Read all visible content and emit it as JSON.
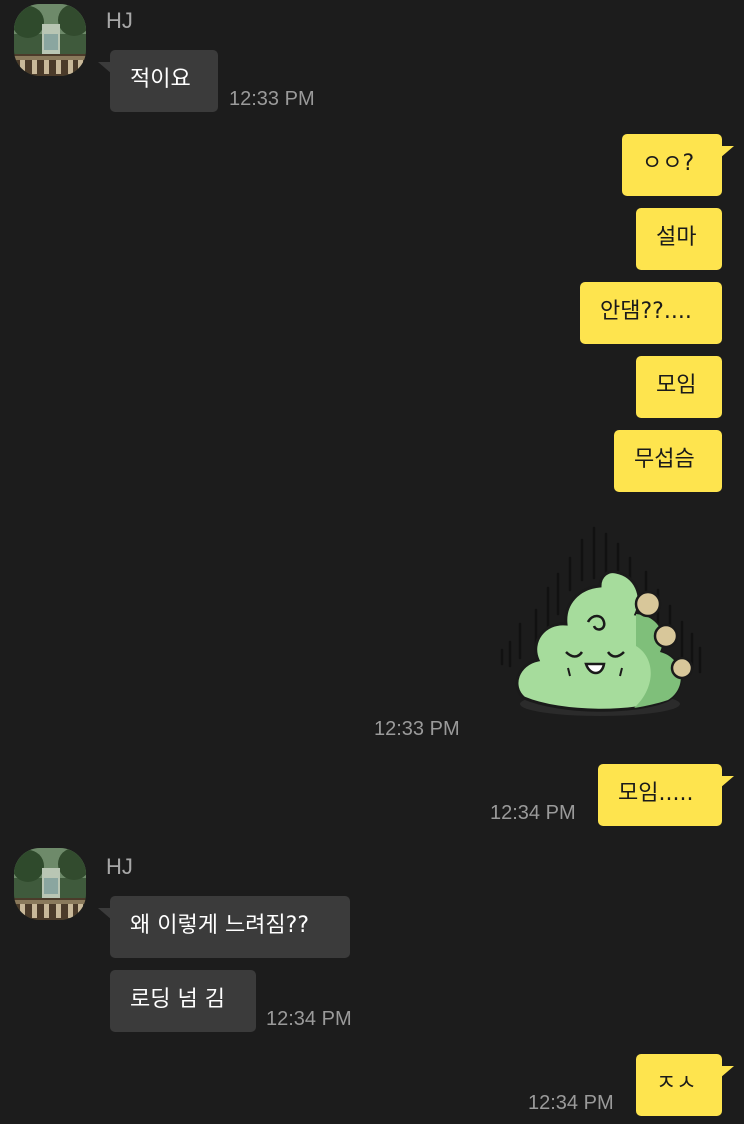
{
  "messages": {
    "m1": {
      "sender": "HJ",
      "text": "적이요",
      "time": "12:33 PM"
    },
    "m2": {
      "text": "ㅇㅇ?"
    },
    "m3": {
      "text": "설마"
    },
    "m4": {
      "text": "안댐??...."
    },
    "m5": {
      "text": "모임"
    },
    "m6": {
      "text": "무섭슴"
    },
    "m7": {
      "sticker": "green-poop-character-sticker",
      "time": "12:33 PM"
    },
    "m8": {
      "text": "모임.....",
      "time": "12:34 PM"
    },
    "m9": {
      "sender": "HJ",
      "text": "왜 이렇게 느려짐??"
    },
    "m10": {
      "text": "로딩 넘 김",
      "time": "12:34 PM"
    },
    "m11": {
      "text": "ㅈㅅ",
      "time": "12:34 PM"
    }
  },
  "colors": {
    "background": "#1c1c1c",
    "incoming_bubble": "#3b3b3b",
    "outgoing_bubble": "#fee44e",
    "timestamp": "#9a9a9a",
    "sender_name": "#a7a7a7"
  }
}
